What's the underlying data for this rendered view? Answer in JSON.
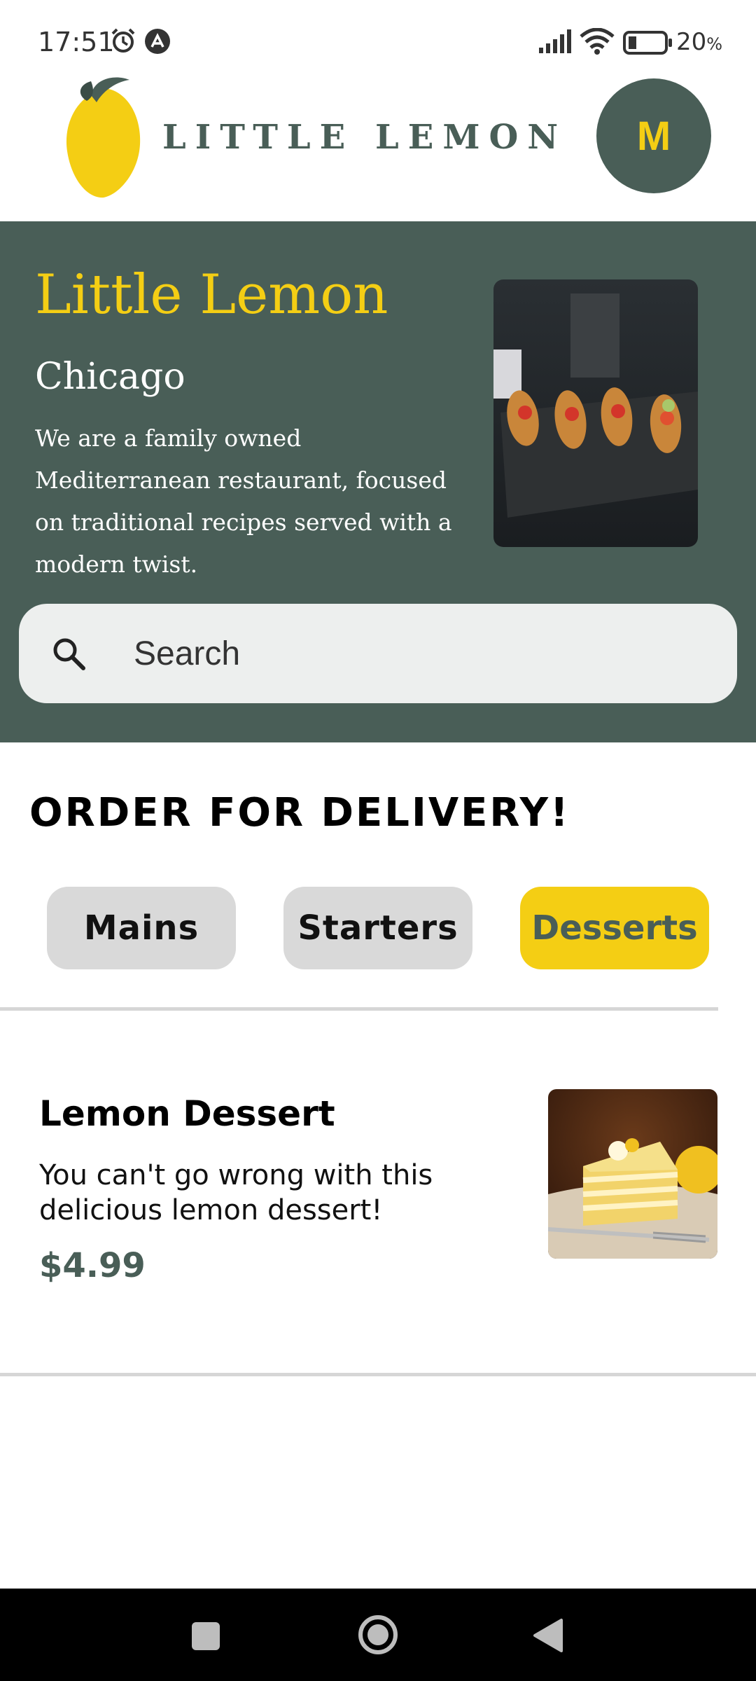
{
  "status_bar": {
    "time": "17:51",
    "battery_percent": "20",
    "battery_symbol": "%"
  },
  "header": {
    "logo_text": "LITTLE LEMON",
    "avatar_initial": "M"
  },
  "hero": {
    "title": "Little Lemon",
    "city": "Chicago",
    "description": "We are a family owned Mediterranean restaurant, focused on traditional recipes served with a modern twist."
  },
  "search": {
    "placeholder": "Search"
  },
  "delivery": {
    "title": "ORDER FOR DELIVERY!",
    "categories": [
      {
        "label": "Mains",
        "active": false
      },
      {
        "label": "Starters",
        "active": false
      },
      {
        "label": "Desserts",
        "active": true
      }
    ]
  },
  "menu_items": [
    {
      "name": "Lemon Dessert",
      "description": "You can't go wrong with this delicious lemon dessert!",
      "price": "$4.99"
    }
  ],
  "colors": {
    "primary_green": "#495e57",
    "primary_yellow": "#f4ce14",
    "chip_gray": "#d9d9d9",
    "search_bg": "#edefee"
  }
}
